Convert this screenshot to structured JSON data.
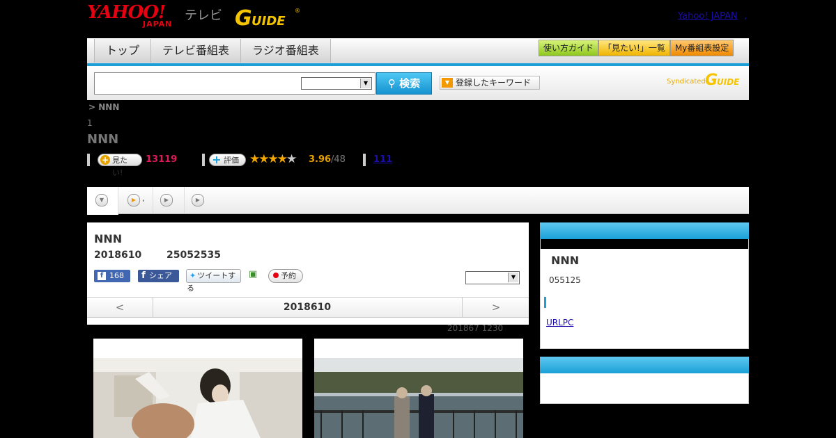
{
  "header": {
    "logo_yahoo": "YAHOO!",
    "logo_japan": "JAPAN",
    "logo_tv": "テレビ",
    "top_link": "Yahoo! JAPAN",
    "top_link_trailing": ","
  },
  "nav": {
    "tabs": [
      "トップ",
      "テレビ番組表",
      "ラジオ番組表"
    ],
    "buttons": [
      "使い方ガイド",
      "「見たい!」一覧",
      "My番組表設定"
    ]
  },
  "search": {
    "button_label": "検索",
    "keywords_label": "登録したキーワード",
    "syndicated": "Syndicated"
  },
  "breadcrumb": "> NNN",
  "episode_number": "1",
  "program_title": "NNN",
  "stats": {
    "want_label": "見たい!",
    "want_count": "13119",
    "rate_label": "評価",
    "rating": 3.96,
    "rating_text": "3.96",
    "rating_count": "/48",
    "stars_filled": 4,
    "review_link": "111"
  },
  "tabs_strip": {
    "tab2_suffix": ","
  },
  "card": {
    "title": "NNN",
    "date": "2018610",
    "time": "25052535",
    "fb_like_count": "168",
    "fb_share_label": "シェア",
    "tweet_label": "ツイートする",
    "reserve_label": "予約",
    "pager_prev": "<",
    "pager_date": "2018610",
    "pager_next": ">",
    "updated": "201867  1230"
  },
  "sidebar": {
    "title": "NNN",
    "sub": "055125",
    "link": "URLPC"
  },
  "colors": {
    "accent_blue": "#1aa0d6",
    "want_pink": "#e0195a",
    "star_gold": "#f5a800",
    "yahoo_red": "#e60012"
  }
}
